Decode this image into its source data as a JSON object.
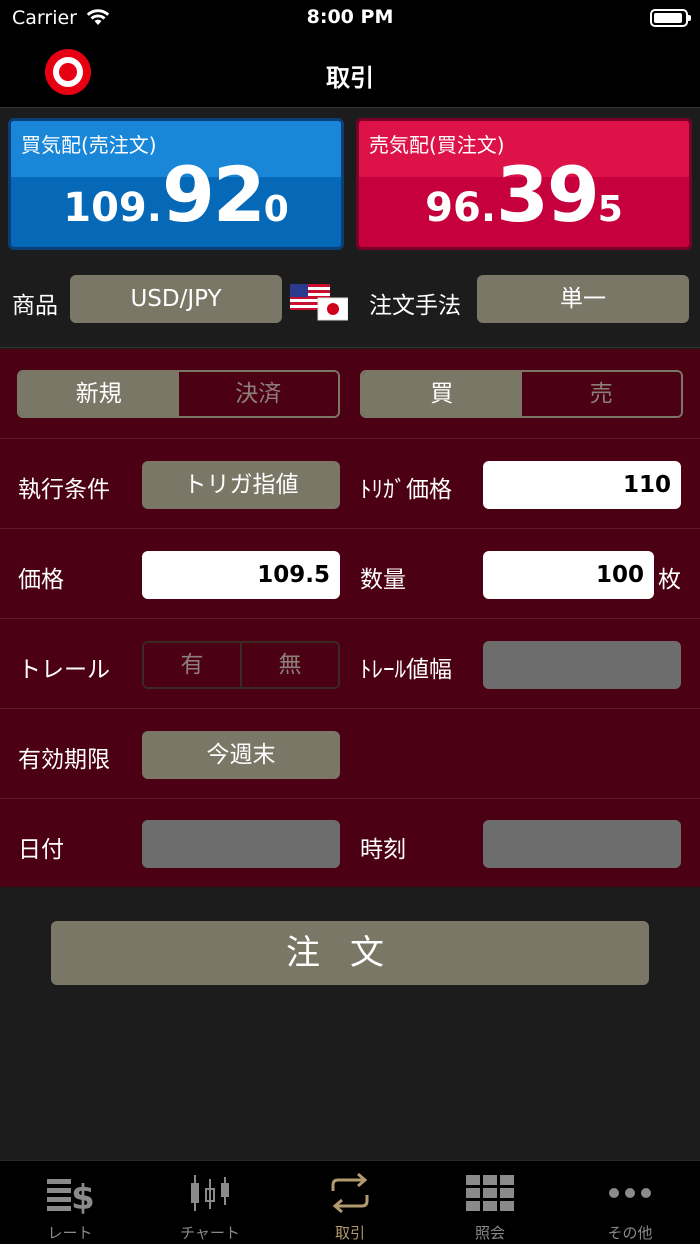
{
  "status_bar": {
    "carrier": "Carrier",
    "time": "8:00 PM"
  },
  "header": {
    "title": "取引"
  },
  "quotes": {
    "bid": {
      "label": "買気配(売注文)",
      "price_small": "109.",
      "price_big": "92",
      "price_tail": "0"
    },
    "ask": {
      "label": "売気配(買注文)",
      "price_small": "96.",
      "price_big": "39",
      "price_tail": "5"
    }
  },
  "product": {
    "label": "商品",
    "value": "USD/JPY",
    "flags": "US/JP flag icon"
  },
  "order_method": {
    "label": "注文手法",
    "value": "単一"
  },
  "trade_type": {
    "options": [
      "新規",
      "決済"
    ],
    "selected": "新規"
  },
  "side": {
    "options": [
      "買",
      "売"
    ],
    "selected": "買"
  },
  "execution": {
    "label": "執行条件",
    "value": "トリガ指値"
  },
  "trigger_price": {
    "label": "ﾄﾘｶﾞ価格",
    "value": "110"
  },
  "price": {
    "label": "価格",
    "value": "109.5"
  },
  "quantity": {
    "label": "数量",
    "value": "100",
    "unit": "枚"
  },
  "trail": {
    "label": "トレール",
    "options": [
      "有",
      "無"
    ]
  },
  "trail_width": {
    "label": "ﾄﾚｰﾙ値幅",
    "value": ""
  },
  "expiry": {
    "label": "有効期限",
    "value": "今週末"
  },
  "date": {
    "label": "日付",
    "value": ""
  },
  "time_field": {
    "label": "時刻",
    "value": ""
  },
  "order_button": {
    "label": "注文"
  },
  "tabbar": {
    "items": [
      {
        "label": "レート",
        "icon": "rate-icon"
      },
      {
        "label": "チャート",
        "icon": "chart-icon"
      },
      {
        "label": "取引",
        "icon": "trade-icon"
      },
      {
        "label": "照会",
        "icon": "grid-icon"
      },
      {
        "label": "その他",
        "icon": "more-icon"
      }
    ],
    "active": "取引"
  },
  "colors": {
    "bid": "#0669b8",
    "ask": "#c5003d",
    "form_bg": "#4b0014",
    "button": "#7a7766",
    "active_tab": "#b19a6e"
  }
}
